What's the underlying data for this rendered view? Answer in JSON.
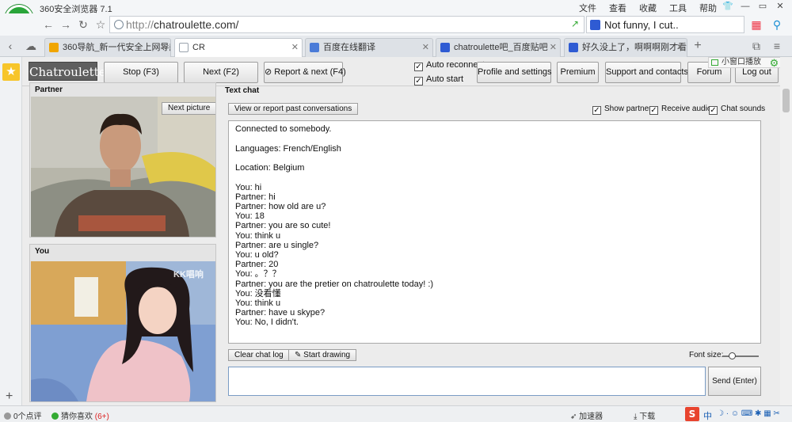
{
  "browser": {
    "title": "360安全浏览器 7.1",
    "menus": [
      "文件",
      "查看",
      "收藏",
      "工具",
      "帮助"
    ],
    "url_prefix": "http://",
    "url_host": "chatroulette.com/",
    "search_text": "Not funny, I cut..",
    "tabs": [
      {
        "label": "360导航_新一代安全上网导航",
        "icon_color": "#f0a500",
        "active": false
      },
      {
        "label": "CR",
        "icon_color": "#9aa3ad",
        "active": true
      },
      {
        "label": "百度在线翻译",
        "icon_color": "#4a7bd8",
        "active": false
      },
      {
        "label": "chatroulette吧_百度贴吧",
        "icon_color": "#2f5bd3",
        "active": false
      },
      {
        "label": "好久没上了，啊啊啊刚才看见",
        "icon_color": "#2f5bd3",
        "active": false
      }
    ],
    "float_window_label": "小窗口播放"
  },
  "toolbar": {
    "brand": "Chatroulette",
    "stop": "Stop (F3)",
    "next": "Next (F2)",
    "report_next": "Report & next (F4)",
    "auto_reconnect": "Auto reconnect",
    "auto_start": "Auto start",
    "profile": "Profile and settings",
    "premium": "Premium",
    "support": "Support and contacts",
    "forum": "Forum",
    "logout": "Log out"
  },
  "partner_panel": {
    "header": "Partner",
    "next_picture": "Next picture",
    "watermark": ""
  },
  "you_panel": {
    "header": "You",
    "watermark": "KK唱响"
  },
  "text_chat": {
    "header": "Text chat",
    "view_report": "View or report past conversations",
    "show_partner": "Show partner",
    "receive_audio": "Receive audio",
    "chat_sounds": "Chat sounds",
    "messages": [
      "Connected to somebody.",
      "",
      "Languages: French/English",
      "",
      "Location: Belgium",
      "",
      "You: hi",
      "Partner: hi",
      "Partner: how old are u?",
      "You: 18",
      "Partner: you are so cute!",
      "You: think u",
      "Partner: are u single?",
      "You: u old?",
      "Partner: 20",
      "You: 。？？",
      "Partner: you are the pretier on chatroulette today! :)",
      "You: 没看懂",
      "You: think u",
      "Partner: have u skype?",
      "You: No, I didn't."
    ],
    "clear_log": "Clear chat log",
    "start_drawing": "Start drawing",
    "font_size_label": "Font size:",
    "send": "Send (Enter)",
    "input_value": ""
  },
  "statusbar": {
    "reviews": "0个点评",
    "guess": "猜你喜欢",
    "guess_count": "(6+)",
    "accelerator": "加速器",
    "download": "下载",
    "ime": "中"
  }
}
